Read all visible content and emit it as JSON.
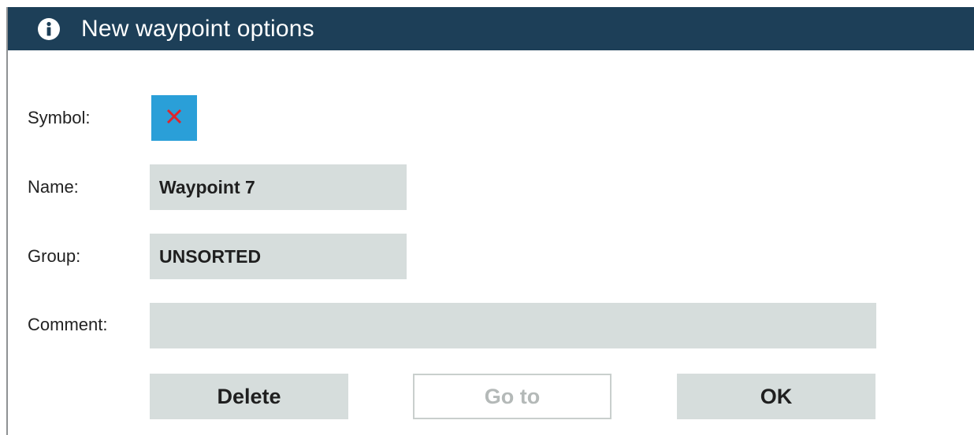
{
  "dialog": {
    "title": "New waypoint options",
    "title_icon": "info-icon",
    "colors": {
      "titlebar": "#1d3f58",
      "symbol_bg": "#2a9fd8",
      "symbol_mark": "#e0252b",
      "field_bg": "#d6dddc",
      "disabled_text": "#b4b9b8"
    }
  },
  "form": {
    "symbol_label": "Symbol:",
    "symbol_icon": "red-x-icon",
    "name_label": "Name:",
    "name_value": "Waypoint 7",
    "group_label": "Group:",
    "group_value": "UNSORTED",
    "comment_label": "Comment:",
    "comment_value": ""
  },
  "buttons": {
    "delete_label": "Delete",
    "goto_label": "Go to",
    "ok_label": "OK"
  }
}
